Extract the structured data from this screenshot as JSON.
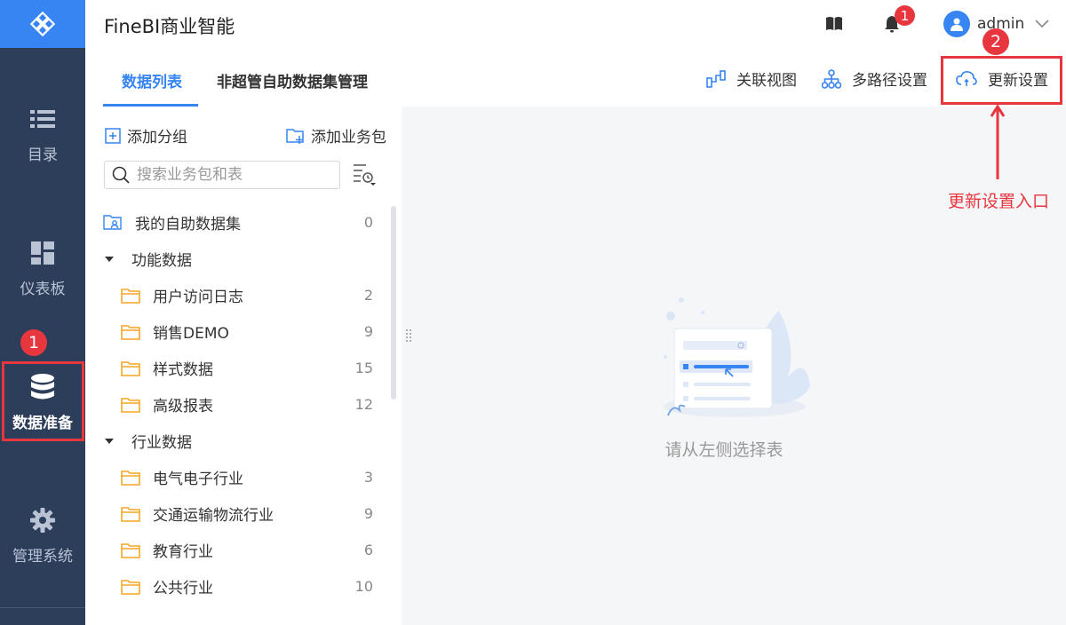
{
  "header": {
    "title": "FineBI商业智能",
    "notification_count": "1",
    "user_name": "admin"
  },
  "nav": {
    "items": [
      {
        "label": "目录",
        "icon": "list-icon"
      },
      {
        "label": "仪表板",
        "icon": "dashboard-icon"
      },
      {
        "label": "数据准备",
        "icon": "database-icon",
        "active": true
      },
      {
        "label": "管理系统",
        "icon": "gear-icon"
      }
    ]
  },
  "tabs": [
    {
      "label": "数据列表"
    },
    {
      "label": "非超管自助数据集管理"
    }
  ],
  "toolbar": {
    "relation_view": "关联视图",
    "multipath": "多路径设置",
    "update_settings": "更新设置"
  },
  "panel": {
    "add_group": "添加分组",
    "add_package": "添加业务包",
    "search_placeholder": "搜索业务包和表",
    "my_dataset": {
      "label": "我的自助数据集",
      "count": "0"
    },
    "groups": [
      {
        "label": "功能数据",
        "children": [
          {
            "label": "用户访问日志",
            "count": "2"
          },
          {
            "label": "销售DEMO",
            "count": "9"
          },
          {
            "label": "样式数据",
            "count": "15"
          },
          {
            "label": "高级报表",
            "count": "12"
          }
        ]
      },
      {
        "label": "行业数据",
        "children": [
          {
            "label": "电气电子行业",
            "count": "3"
          },
          {
            "label": "交通运输物流行业",
            "count": "9"
          },
          {
            "label": "教育行业",
            "count": "6"
          },
          {
            "label": "公共行业",
            "count": "10"
          }
        ]
      }
    ]
  },
  "main": {
    "empty_text": "请从左侧选择表"
  },
  "annotations": {
    "num1": "1",
    "num2": "2",
    "label": "更新设置入口"
  },
  "colors": {
    "accent": "#3685f2",
    "nav_bg": "#2d3e5b",
    "annotation": "#e8363e",
    "folder": "#f5a623"
  }
}
